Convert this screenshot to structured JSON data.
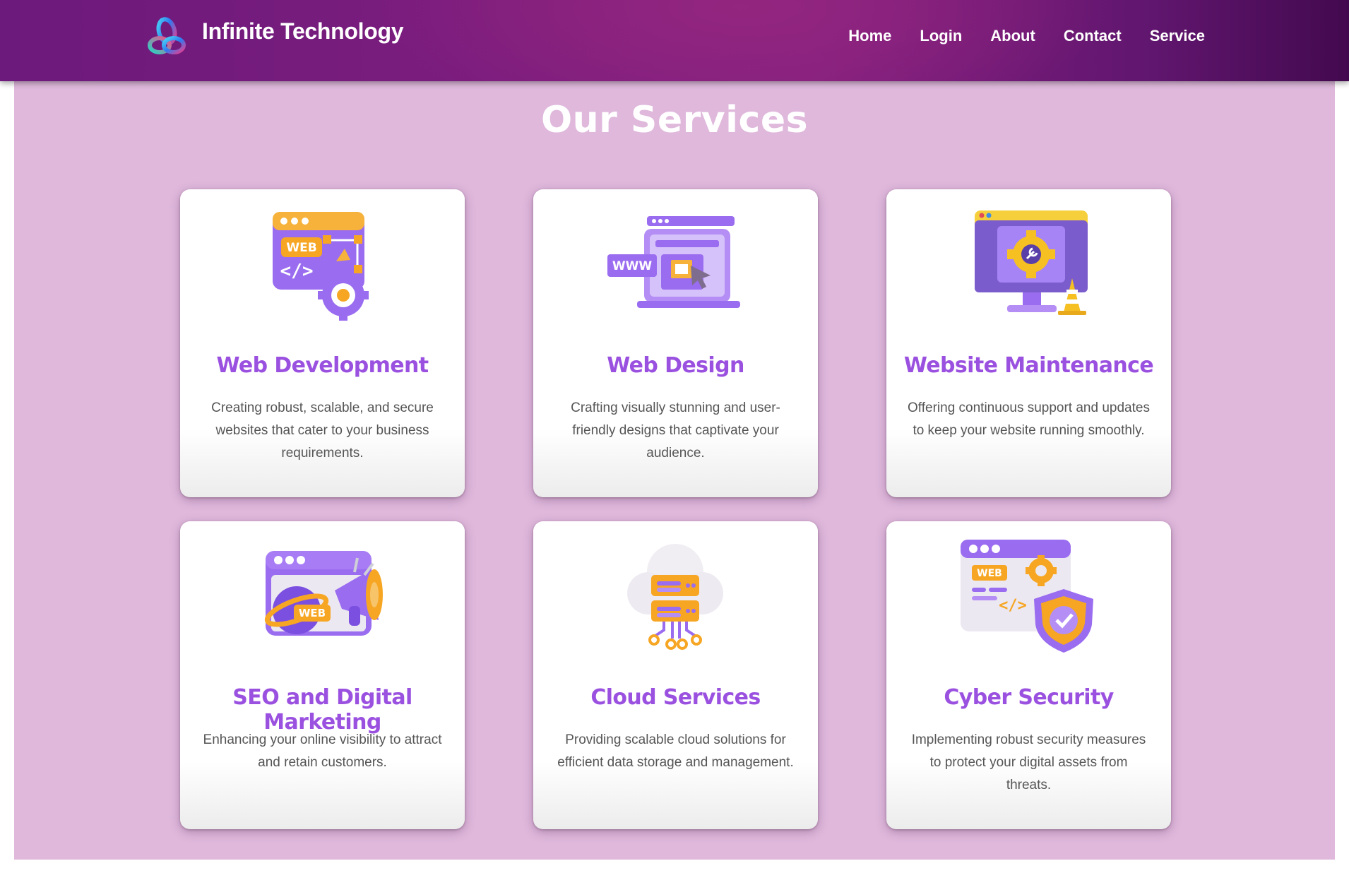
{
  "header": {
    "brand_name": "Infinite Technology",
    "logo_icon": "infinity-rings-logo",
    "nav": [
      {
        "label": "Home"
      },
      {
        "label": "Login"
      },
      {
        "label": "About"
      },
      {
        "label": "Contact"
      },
      {
        "label": "Service"
      }
    ]
  },
  "main": {
    "title": "Our Services",
    "cards": [
      {
        "icon": "web-development-icon",
        "title": "Web Development",
        "text": "Creating robust, scalable, and secure websites that cater to your business requirements.",
        "icon_badge": "WEB"
      },
      {
        "icon": "web-design-icon",
        "title": "Web Design",
        "text": "Crafting visually stunning and user-friendly designs that captivate your audience.",
        "icon_badge": "WWW"
      },
      {
        "icon": "website-maintenance-icon",
        "title": "Website Maintenance",
        "text": "Offering continuous support and updates to keep your website running smoothly."
      },
      {
        "icon": "seo-marketing-icon",
        "title": "SEO and Digital Marketing",
        "text": "Enhancing your online visibility to attract and retain customers.",
        "icon_badge": "WEB"
      },
      {
        "icon": "cloud-services-icon",
        "title": "Cloud Services",
        "text": "Providing scalable cloud solutions for efficient data storage and management."
      },
      {
        "icon": "cyber-security-icon",
        "title": "Cyber Security",
        "text": "Implementing robust security measures to protect your digital assets from threats.",
        "icon_badge": "WEB"
      }
    ]
  },
  "colors": {
    "header_purple": "#7d1d7e",
    "section_pink": "#dfb8dc",
    "card_title_purple": "#9b51e0",
    "icon_purple": "#9a6cf0",
    "icon_orange": "#f6a623"
  }
}
